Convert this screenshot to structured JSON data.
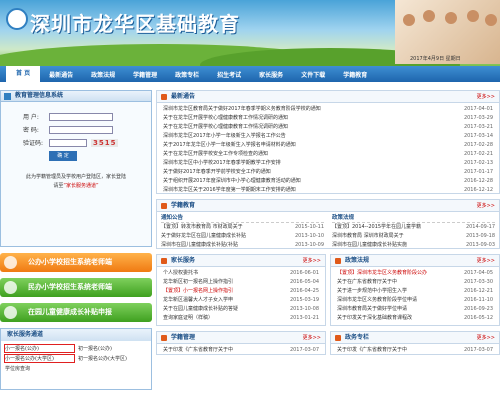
{
  "banner": {
    "title": "深圳市龙华区基础教育",
    "date": "2017年4月9日 星期日"
  },
  "nav": [
    "首 页",
    "最新通告",
    "政策法规",
    "学籍管理",
    "政策专栏",
    "招生考试",
    "家长服务",
    "文件下载",
    "学籍教育"
  ],
  "login": {
    "title": "教育管理信息系统",
    "user_label": "用  户:",
    "pwd_label": "密  码:",
    "code_label": "验证码:",
    "captcha": "3515",
    "button": "确 定",
    "note1": "此为学籍管理员及学校用户登陆区，家长登陆",
    "note2a": "请至",
    "note2b": "“家长服务通道”"
  },
  "bars": [
    "公办小学校招生系统老师端",
    "民办小学校招生系统老师端",
    "在园儿童健康成长补贴申报"
  ],
  "service": {
    "title": "家长服务通道",
    "items": [
      "小一报名(公办)",
      "初一报名(公办)",
      "小一报名公办(大学区)",
      "初一报名公办(大学区)",
      "学位房查询"
    ]
  },
  "latest": {
    "title": "最新通告",
    "more": "更多>>",
    "items": [
      {
        "t": "深圳市龙华区教育局关于做好2017年春季学期义务教育阶段学校的通知",
        "d": "2017-04-01"
      },
      {
        "t": "关于在龙华区开展学校心理健康教育工作情况调研的通知",
        "d": "2017-03-29"
      },
      {
        "t": "关于在龙华区开展学校心理健康教育工作情况调研的通知",
        "d": "2017-03-21"
      },
      {
        "t": "深圳市龙华区2017年小学一年级新生入学报名工作公告",
        "d": "2017-03-14"
      },
      {
        "t": "关于2017年龙华区小学一年级新生入学报名申请材料的通知",
        "d": "2017-02-28"
      },
      {
        "t": "关于在龙华区开展学校安全工作专项检查的通知",
        "d": "2017-02-21"
      },
      {
        "t": "深圳市龙华区中小学校2017年春季学期教学工作安排",
        "d": "2017-02-13"
      },
      {
        "t": "关于做好2017年春季开学前学校安全工作的通知",
        "d": "2017-01-17"
      },
      {
        "t": "关于组织开展2017年度深圳市中小学心理健康教育活动的通知",
        "d": "2016-12-28"
      },
      {
        "t": "深圳市龙华区关于2016学年度第一学期期末工作安排的通知",
        "d": "2016-12-12"
      },
      {
        "t": "关于在深圳市教育局网站开展学校安全教育活动的通知",
        "d": "2016-11-25"
      },
      {
        "t": "深圳市龙华区2016年中小学教师资格认定工作通知",
        "d": "2016-11-14"
      },
      {
        "t": "关于在龙华区开展中小学校园文化建设评比的通知",
        "d": "2016-10-31"
      },
      {
        "t": "关于做好2016年秋季学期学校卫生工作的通知",
        "d": "2016-10-19"
      },
      {
        "t": "关于在龙华区学校开展消防安全宣传教育活动的通知",
        "d": "2016-09-26"
      },
      {
        "t": "深圳市龙华区关于2016年秋季学期开学工作的通知",
        "d": "2016-08-30"
      },
      {
        "t": "关于在深圳市教育局网站公布学校收费标准的通知",
        "d": "2016-07-21"
      },
      {
        "t": "关于在学校开展2016年暑期安全教育活动的通知",
        "d": "2016-07-04"
      },
      {
        "t": "关于在龙华区中小学开展阅读推广活动的通知",
        "d": "2016-06-16"
      },
      {
        "t": "关于在龙华区开展学校卫生检查工作的通知",
        "d": "2016-07-23"
      }
    ]
  },
  "xueji": {
    "title": "学籍教育",
    "more": "更多>>",
    "col1_title": "通知公告",
    "col2_title": "政策法规",
    "col1": [
      {
        "t": "【置顶】转发市教育局 市财政局关于",
        "d": "2015-10-11"
      },
      {
        "t": "关于做好龙华区在园儿童健康成长补贴",
        "d": "2013-10-10"
      },
      {
        "t": "深圳市在园儿童健康成长补贴(补贴",
        "d": "2013-10-09"
      }
    ],
    "col2": [
      {
        "t": "【置顶】2014--2015学年在园儿童学籍",
        "d": "2014-09-17"
      },
      {
        "t": "深圳市教育局 深圳市财政局关于",
        "d": "2013-09-18"
      },
      {
        "t": "深圳市在园儿童健康成长补贴实施",
        "d": "2013-09-03"
      }
    ]
  },
  "jiazhang": {
    "title": "家长服务",
    "more": "更多>>",
    "items": [
      {
        "t": "个人授权委托书",
        "d": "2016-06-01"
      },
      {
        "t": "龙华新区初一报名网上操作指引",
        "d": "2016-05-04"
      },
      {
        "t": "【置顶】小一报名网上操作指引",
        "d": "2016-04-25",
        "tag": true
      },
      {
        "t": "龙华新区温馨大人才子女入学申",
        "d": "2015-03-19"
      },
      {
        "t": "关于在园儿童健康成长补贴的答疑",
        "d": "2013-10-08"
      },
      {
        "t": "查询家庭证明（样稿）",
        "d": "2013-01-21"
      }
    ]
  },
  "zhengce": {
    "title": "政策法规",
    "more": "更多>>",
    "items": [
      {
        "t": "【置顶】深圳市龙华区义务教育阶段公办",
        "d": "2017-04-05",
        "tag": true
      },
      {
        "t": "关于在广东省教育厅关于中",
        "d": "2017-03-30"
      },
      {
        "t": "关于进一步规范中小学招生入学",
        "d": "2016-12-21"
      },
      {
        "t": "深圳市龙华区义务教育阶段学位申请",
        "d": "2016-11-10"
      },
      {
        "t": "深圳市教育局关于做好学位申请",
        "d": "2016-09-23"
      },
      {
        "t": "关于印发关于深化基础教育课程改",
        "d": "2016-05-12"
      }
    ]
  },
  "bottom": {
    "left_title": "学籍管理",
    "right_title": "政务专栏",
    "more": "更多>>",
    "left_item": {
      "t": "关于印发《广东省教育厅关于中",
      "d": "2017-03-07"
    },
    "right_item": {
      "t": "关于印发《广东省教育厅关于中",
      "d": "2017-03-07"
    }
  }
}
